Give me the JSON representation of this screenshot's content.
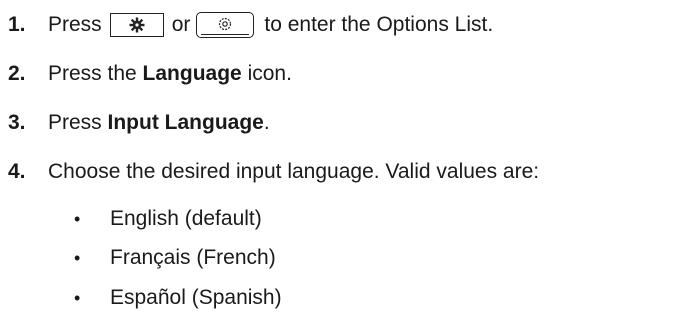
{
  "steps": [
    {
      "number": "1.",
      "before": "Press",
      "or": "or",
      "after": "to enter the Options List.",
      "icons": [
        "gear-key-icon",
        "settings-button-icon"
      ]
    },
    {
      "number": "2.",
      "before": "Press the ",
      "bold": "Language",
      "after": " icon."
    },
    {
      "number": "3.",
      "before": "Press ",
      "bold": "Input Language",
      "after": "."
    },
    {
      "number": "4.",
      "text": "Choose the desired input language. Valid values are:"
    }
  ],
  "options": [
    {
      "bullet": "•",
      "label": "English (default)"
    },
    {
      "bullet": "•",
      "label": "Français (French)"
    },
    {
      "bullet": "•",
      "label": "Español (Spanish)"
    }
  ]
}
